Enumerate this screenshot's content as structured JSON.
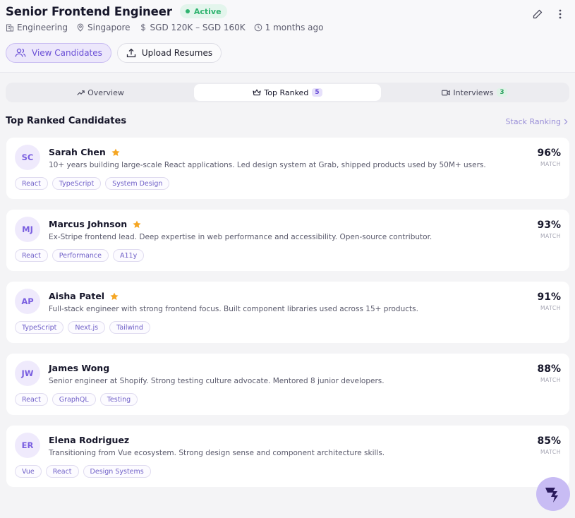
{
  "job": {
    "title": "Senior Frontend Engineer",
    "status": "Active",
    "department": "Engineering",
    "location": "Singapore",
    "salary": "SGD 120K – SGD 160K",
    "posted": "1 months ago"
  },
  "actions": {
    "view_candidates": "View Candidates",
    "upload_resumes": "Upload Resumes"
  },
  "tabs": [
    {
      "label": "Overview",
      "icon": "trend-up-icon",
      "count": null
    },
    {
      "label": "Top Ranked",
      "icon": "crown-icon",
      "count": "5"
    },
    {
      "label": "Interviews",
      "icon": "video-icon",
      "count": "3"
    }
  ],
  "section": {
    "title": "Top Ranked Candidates",
    "link": "Stack Ranking"
  },
  "candidates": [
    {
      "initials": "SC",
      "name": "Sarah Chen",
      "starred": true,
      "description": "10+ years building large-scale React applications. Led design system at Grab, shipped products used by 50M+ users.",
      "tags": [
        "React",
        "TypeScript",
        "System Design"
      ],
      "score": "96%",
      "score_label": "MATCH"
    },
    {
      "initials": "MJ",
      "name": "Marcus Johnson",
      "starred": true,
      "description": "Ex-Stripe frontend lead. Deep expertise in web performance and accessibility. Open-source contributor.",
      "tags": [
        "React",
        "Performance",
        "A11y"
      ],
      "score": "93%",
      "score_label": "MATCH"
    },
    {
      "initials": "AP",
      "name": "Aisha Patel",
      "starred": true,
      "description": "Full-stack engineer with strong frontend focus. Built component libraries used across 15+ products.",
      "tags": [
        "TypeScript",
        "Next.js",
        "Tailwind"
      ],
      "score": "91%",
      "score_label": "MATCH"
    },
    {
      "initials": "JW",
      "name": "James Wong",
      "starred": false,
      "description": "Senior engineer at Shopify. Strong testing culture advocate. Mentored 8 junior developers.",
      "tags": [
        "React",
        "GraphQL",
        "Testing"
      ],
      "score": "88%",
      "score_label": "MATCH"
    },
    {
      "initials": "ER",
      "name": "Elena Rodriguez",
      "starred": false,
      "description": "Transitioning from Vue ecosystem. Strong design sense and component architecture skills.",
      "tags": [
        "Vue",
        "React",
        "Design Systems"
      ],
      "score": "85%",
      "score_label": "MATCH"
    }
  ],
  "colors": {
    "accent": "#6a4fd6",
    "status_green": "#2fb36f",
    "star": "#f5a623"
  }
}
